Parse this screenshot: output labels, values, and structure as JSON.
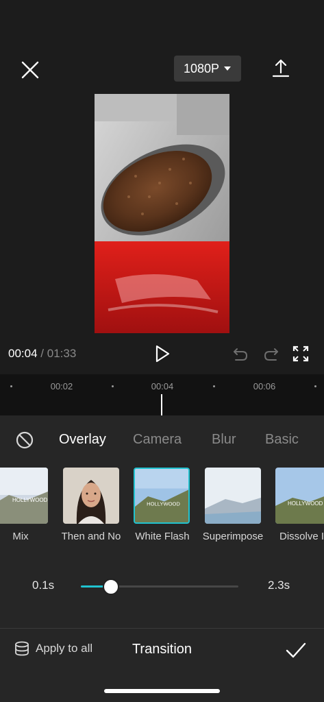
{
  "topbar": {
    "resolution_label": "1080P",
    "close_icon": "close-icon",
    "export_icon": "export-icon"
  },
  "playback": {
    "current_time": "00:04",
    "separator": "/",
    "total_time": "01:33"
  },
  "timeline": {
    "ticks": [
      "00:02",
      "00:04",
      "00:06"
    ]
  },
  "transition_panel": {
    "tabs": [
      "Overlay",
      "Camera",
      "Blur",
      "Basic"
    ],
    "active_tab": "Overlay",
    "items": [
      {
        "label": "Mix"
      },
      {
        "label": "Then and No"
      },
      {
        "label": "White Flash",
        "selected": true
      },
      {
        "label": "Superimpose"
      },
      {
        "label": "Dissolve I"
      }
    ],
    "duration_min": "0.1s",
    "duration_max": "2.3s",
    "duration_value_fraction": 0.19,
    "apply_to_all_label": "Apply to all",
    "title": "Transition"
  },
  "colors": {
    "accent": "#20c3d0",
    "background": "#1c1c1c",
    "panel": "#262626"
  }
}
